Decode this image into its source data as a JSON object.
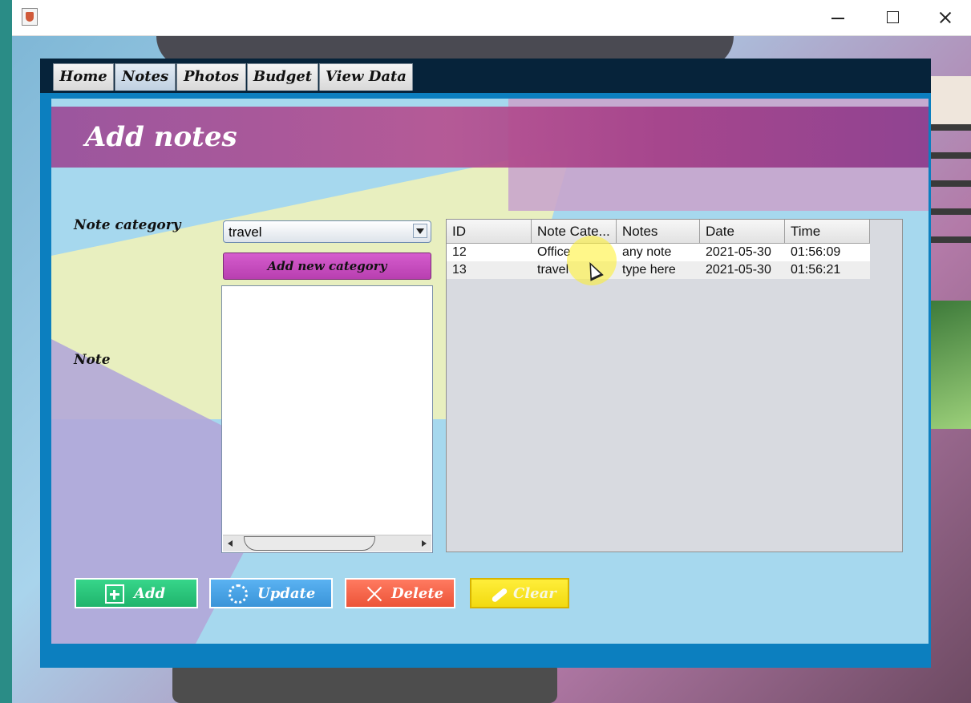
{
  "window": {
    "icon": "java-cup-icon",
    "controls": [
      "minimize-icon",
      "maximize-icon",
      "close-icon"
    ]
  },
  "tabs": [
    {
      "label": "Home",
      "active": false
    },
    {
      "label": "Notes",
      "active": true
    },
    {
      "label": "Photos",
      "active": false
    },
    {
      "label": "Budget",
      "active": false
    },
    {
      "label": "View Data",
      "active": false
    }
  ],
  "page": {
    "title": "Add notes"
  },
  "form": {
    "category_label": "Note category",
    "note_label": "Note",
    "category_selected": "travel",
    "add_category_label": "Add new category",
    "note_text": ""
  },
  "table": {
    "columns": [
      "ID",
      "Note Cate...",
      "Notes",
      "Date",
      "Time"
    ],
    "rows": [
      [
        "12",
        "Office",
        "any note",
        "2021-05-30",
        "01:56:09"
      ],
      [
        "13",
        "travel",
        "type here",
        "2021-05-30",
        "01:56:21"
      ]
    ]
  },
  "actions": {
    "add": "Add",
    "update": "Update",
    "delete": "Delete",
    "clear": "Clear"
  },
  "colors": {
    "add": "#1fb46c",
    "update": "#3a94d8",
    "delete": "#ec5438",
    "clear": "#f2da10",
    "add_category": "#c64bbd",
    "header_band": "#a5488f"
  }
}
